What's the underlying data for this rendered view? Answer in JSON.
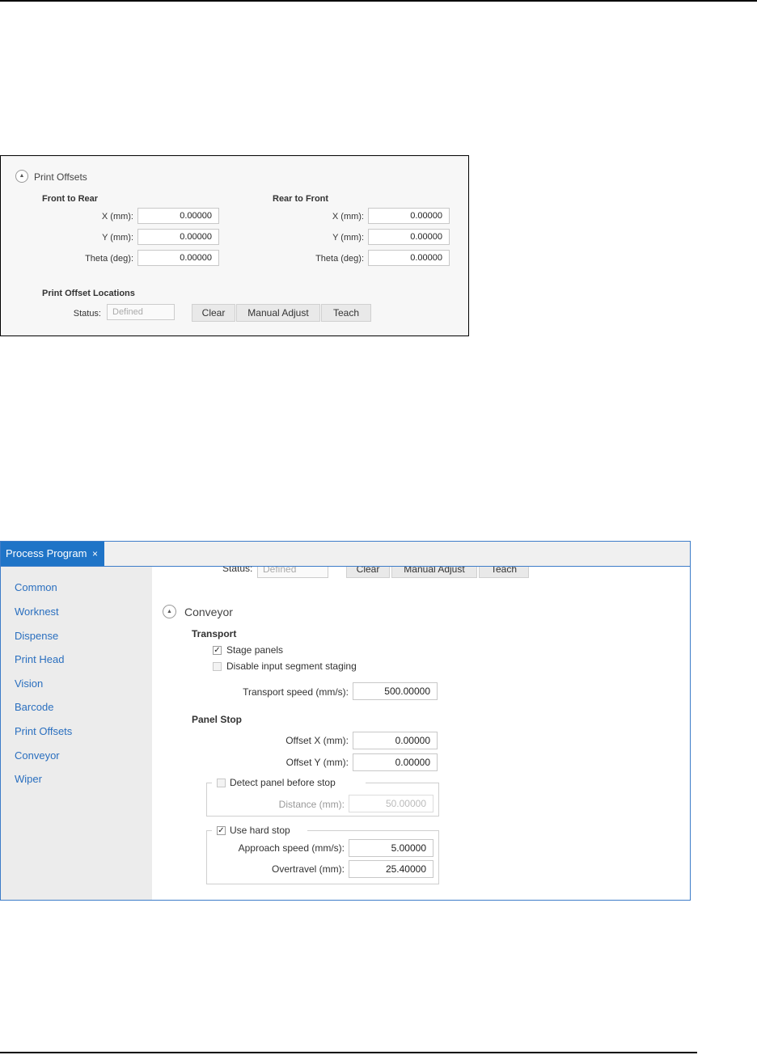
{
  "print_offsets": {
    "title": "Print Offsets",
    "front_to_rear": {
      "heading": "Front to Rear",
      "x_label": "X (mm):",
      "x_value": "0.00000",
      "y_label": "Y (mm):",
      "y_value": "0.00000",
      "theta_label": "Theta (deg):",
      "theta_value": "0.00000"
    },
    "rear_to_front": {
      "heading": "Rear to Front",
      "x_label": "X (mm):",
      "x_value": "0.00000",
      "y_label": "Y (mm):",
      "y_value": "0.00000",
      "theta_label": "Theta (deg):",
      "theta_value": "0.00000"
    },
    "locations": {
      "heading": "Print Offset Locations",
      "status_label": "Status:",
      "status_value": "Defined",
      "clear_label": "Clear",
      "manual_adjust_label": "Manual Adjust",
      "teach_label": "Teach"
    }
  },
  "process_program": {
    "tab_label": "Process Program",
    "tab_close": "×",
    "sidebar": {
      "items": [
        "Common",
        "Worknest",
        "Dispense",
        "Print Head",
        "Vision",
        "Barcode",
        "Print Offsets",
        "Conveyor",
        "Wiper"
      ]
    },
    "scrolled_row": {
      "status_label": "Status:",
      "status_value": "Defined",
      "clear_label": "Clear",
      "manual_adjust_label": "Manual Adjust",
      "teach_label": "Teach"
    },
    "conveyor": {
      "title": "Conveyor",
      "transport": {
        "heading": "Transport",
        "stage_panels_label": "Stage panels",
        "stage_panels_checked": true,
        "disable_staging_label": "Disable input segment staging",
        "disable_staging_checked": false,
        "speed_label": "Transport speed (mm/s):",
        "speed_value": "500.00000"
      },
      "panel_stop": {
        "heading": "Panel Stop",
        "offset_x_label": "Offset X (mm):",
        "offset_x_value": "0.00000",
        "offset_y_label": "Offset Y (mm):",
        "offset_y_value": "0.00000",
        "detect_label": "Detect panel before stop",
        "detect_checked": false,
        "distance_label": "Distance (mm):",
        "distance_value": "50.00000",
        "hard_stop_label": "Use hard stop",
        "hard_stop_checked": true,
        "approach_label": "Approach speed (mm/s):",
        "approach_value": "5.00000",
        "overtravel_label": "Overtravel (mm):",
        "overtravel_value": "25.40000"
      }
    }
  },
  "icons": {
    "check_mark": "✓",
    "collapse_glyph": "▲"
  },
  "colors": {
    "accent": "#1f74c7",
    "nav_text": "#2a6fbf",
    "frame_border": "#3d7cc9"
  }
}
